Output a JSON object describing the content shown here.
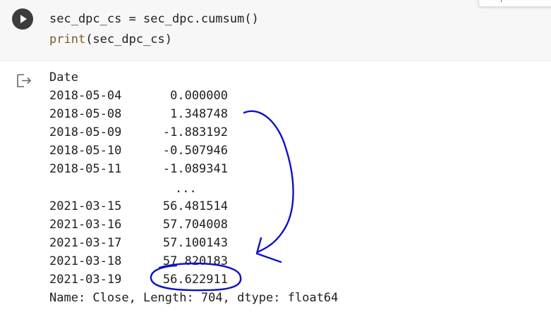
{
  "cell": {
    "code_line1": "sec_dpc_cs = sec_dpc.cumsum()",
    "code_line2_fn": "print",
    "code_line2_args": "(sec_dpc_cs)",
    "run_icon": "play-icon",
    "widget_text": "|"
  },
  "output": {
    "icon": "output-redirect-icon",
    "index_label": "Date",
    "rows": [
      {
        "date": "2018-05-04",
        "value": "0.000000"
      },
      {
        "date": "2018-05-08",
        "value": "1.348748"
      },
      {
        "date": "2018-05-09",
        "value": "-1.883192"
      },
      {
        "date": "2018-05-10",
        "value": "-0.507946"
      },
      {
        "date": "2018-05-11",
        "value": "-1.089341"
      }
    ],
    "ellipsis": "...",
    "rows_tail": [
      {
        "date": "2021-03-15",
        "value": "56.481514"
      },
      {
        "date": "2021-03-16",
        "value": "57.704008"
      },
      {
        "date": "2021-03-17",
        "value": "57.100143"
      },
      {
        "date": "2021-03-18",
        "value": "57.820183"
      },
      {
        "date": "2021-03-19",
        "value": "56.622911"
      }
    ],
    "footer": "Name: Close, Length: 704, dtype: float64"
  },
  "annotation": {
    "ink_color": "#1010c8"
  }
}
